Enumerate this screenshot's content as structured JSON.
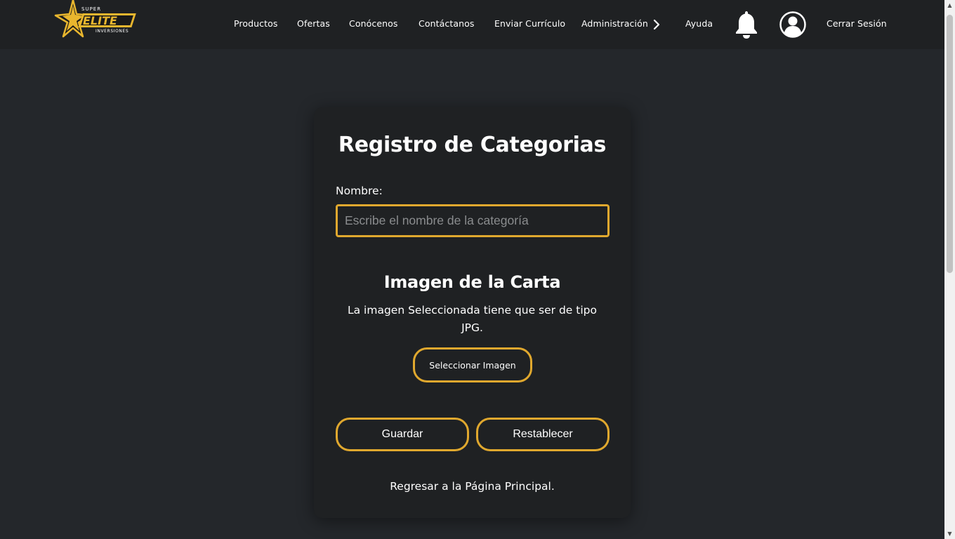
{
  "header": {
    "logo": {
      "top_text": "SUPER",
      "main_text": "ELITE",
      "bottom_text": "INVERSIONES",
      "colors": {
        "gold": "#e8b62e",
        "white": "#ffffff"
      }
    },
    "nav": {
      "productos": "Productos",
      "ofertas": "Ofertas",
      "conocenos": "Conócenos",
      "contactanos": "Contáctanos",
      "enviar_curriculo": "Enviar Currículo",
      "administracion": "Administración",
      "ayuda": "Ayuda",
      "cerrar_sesion": "Cerrar Sesión"
    },
    "icons": {
      "chevron": "chevron-right-icon",
      "bell": "bell-icon",
      "user": "user-circle-icon"
    }
  },
  "form": {
    "title": "Registro de Categorias",
    "name_label": "Nombre:",
    "name_value": "",
    "name_placeholder": "Escribe el nombre de la categoría",
    "image_section_title": "Imagen de la Carta",
    "image_section_desc": "La imagen Seleccionada tiene que ser de tipo JPG.",
    "select_image_label": "Seleccionar Imagen",
    "save_label": "Guardar",
    "reset_label": "Restablecer",
    "back_link": "Regresar a la Página Principal."
  },
  "theme": {
    "background": "#24272b",
    "surface": "#1f2123",
    "accent": "#e0a82e",
    "text": "#ffffff"
  }
}
